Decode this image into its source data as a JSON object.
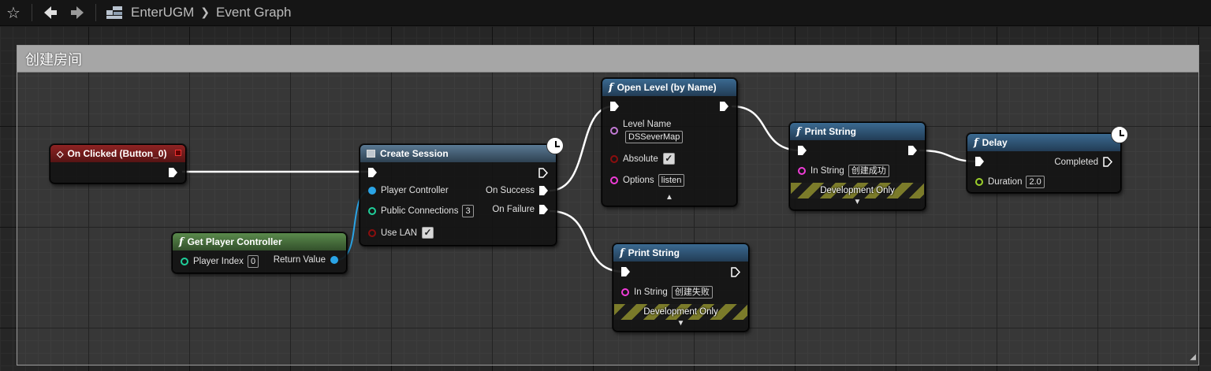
{
  "toolbar": {
    "favorite_icon": "star-icon",
    "back_icon": "arrow-left-icon",
    "forward_icon": "arrow-right-icon",
    "blueprint_icon": "blueprint-icon"
  },
  "breadcrumb": {
    "asset": "EnterUGM",
    "graph": "Event Graph"
  },
  "comment": {
    "title": "创建房间"
  },
  "nodes": {
    "on_clicked": {
      "title": "On Clicked (Button_0)"
    },
    "get_player_controller": {
      "title": "Get Player Controller",
      "player_index_label": "Player Index",
      "player_index_value": "0",
      "return_value_label": "Return Value"
    },
    "create_session": {
      "title": "Create Session",
      "player_controller_label": "Player Controller",
      "public_connections_label": "Public Connections",
      "public_connections_value": "3",
      "use_lan_label": "Use LAN",
      "use_lan_checked": true,
      "on_success_label": "On Success",
      "on_failure_label": "On Failure"
    },
    "open_level": {
      "title": "Open Level (by Name)",
      "level_name_label": "Level Name",
      "level_name_value": "DSSeverMap",
      "absolute_label": "Absolute",
      "absolute_checked": true,
      "options_label": "Options",
      "options_value": "listen"
    },
    "print_success": {
      "title": "Print String",
      "in_string_label": "In String",
      "in_string_value": "创建成功",
      "dev_only": "Development Only"
    },
    "print_failure": {
      "title": "Print String",
      "in_string_label": "In String",
      "in_string_value": "创建失败",
      "dev_only": "Development Only"
    },
    "delay": {
      "title": "Delay",
      "completed_label": "Completed",
      "duration_label": "Duration",
      "duration_value": "2.0"
    }
  },
  "colors": {
    "event_header": "#8e2323",
    "function_header": "#3b6a91",
    "pure_header": "#5a8a4c",
    "object_pin": "#2aa4e6",
    "int_pin": "#1fcf9a",
    "bool_pin": "#8c0e0e",
    "name_pin": "#c47bd6",
    "string_pin": "#f03cd8",
    "float_pin": "#9ccf2b"
  }
}
